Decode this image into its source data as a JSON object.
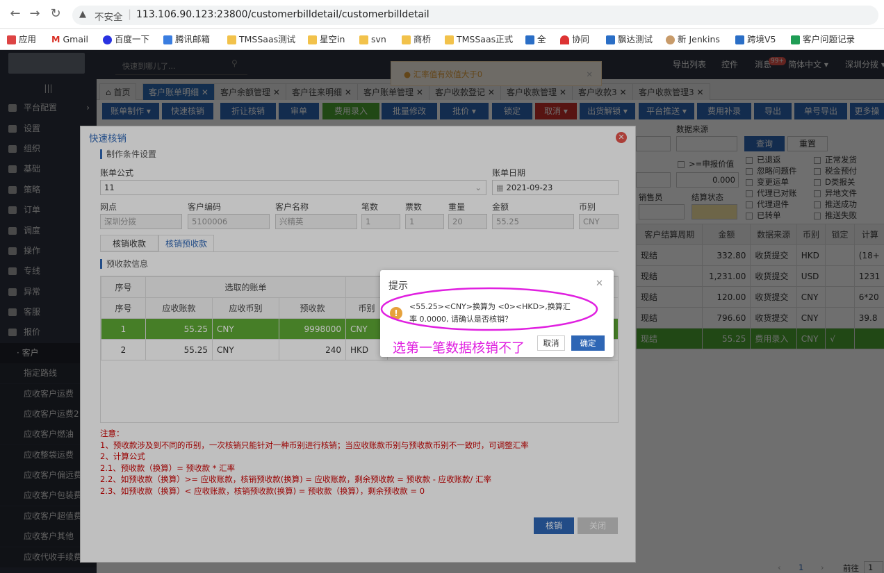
{
  "browser": {
    "security": "不安全",
    "url": "113.106.90.123:23800/customerbilldetail/customerbilldetail",
    "bookmarks": [
      "应用",
      "Gmail",
      "百度一下",
      "腾讯邮箱",
      "TMSSaas测试",
      "星空in",
      "svn",
      "商桥",
      "TMSSaas正式",
      "全",
      "协同",
      "飘达测试",
      "新 Jenkins",
      "跨境V5",
      "客户问题记录"
    ]
  },
  "header": {
    "search_placeholder": "快速到哪儿了...",
    "export_list": "导出列表",
    "controls": "控件",
    "messages": "消息",
    "msg_badge": "99+",
    "language": "简体中文",
    "branch": "深圳分拨"
  },
  "notice": "汇率值有效值大于0",
  "sidebar": {
    "items": [
      "平台配置",
      "设置",
      "组织",
      "基础",
      "策略",
      "订单",
      "调度",
      "操作",
      "专线",
      "异常",
      "客服",
      "报价",
      "客户"
    ],
    "subitems": [
      "指定路线",
      "应收客户运费",
      "应收客户运费2",
      "应收客户燃油",
      "应收整袋运费",
      "应收客户偏远费",
      "应收客户包装费",
      "应收客户超值费",
      "应收客户其他",
      "应收代收手续费"
    ]
  },
  "tabs": [
    "首页",
    "客户账单明细",
    "客户余额管理",
    "客户往来明细",
    "客户账单管理",
    "客户收款登记",
    "客户收款管理",
    "客户收款3",
    "客户收款管理3"
  ],
  "toolbar": [
    "账单制作",
    "快速核销",
    "折让核销",
    "审单",
    "费用录入",
    "批量修改",
    "批价",
    "锁定",
    "取消",
    "出货解锁",
    "平台推送",
    "费用补录",
    "导出",
    "单号导出",
    "更多操"
  ],
  "behind": {
    "data_source_label": "数据来源",
    "query": "查询",
    "reset": "重置",
    "apply_value": ">=申报价值",
    "apply_amount": "0.000",
    "salesperson": "销售员",
    "settle_status": "结算状态",
    "checks_a": [
      "已退返",
      "忽略问题件",
      "变更运单",
      "代理已对账",
      "代理退件",
      "已转单"
    ],
    "checks_b": [
      "正常发货",
      "税金预付",
      "D类报关",
      "异地文件",
      "推送成功",
      "推送失败"
    ],
    "columns": [
      "客户结算周期",
      "金额",
      "数据来源",
      "币别",
      "锁定",
      "计算"
    ],
    "rows": [
      [
        "现结",
        "332.80",
        "收货提交",
        "HKD",
        "",
        "(18+"
      ],
      [
        "现结",
        "1,231.00",
        "收货提交",
        "USD",
        "",
        "1231"
      ],
      [
        "现结",
        "120.00",
        "收货提交",
        "CNY",
        "",
        "6*20"
      ],
      [
        "现结",
        "796.60",
        "收货提交",
        "CNY",
        "",
        "39.8"
      ],
      [
        "现结",
        "55.25",
        "费用录入",
        "CNY",
        "√",
        ""
      ]
    ],
    "pager_page": "1",
    "pager_goto": "前往",
    "pager_input": "1"
  },
  "dialog": {
    "title": "快速核销",
    "section1": "制作条件设置",
    "formula_label": "账单公式",
    "formula_value": "11",
    "date_label": "账单日期",
    "date_value": "2021-09-23",
    "fields": [
      {
        "label": "网点",
        "value": "深圳分拨"
      },
      {
        "label": "客户编码",
        "value": "5100006"
      },
      {
        "label": "客户名称",
        "value": "兴精英"
      },
      {
        "label": "笔数",
        "value": "1"
      },
      {
        "label": "票数",
        "value": "1"
      },
      {
        "label": "重量",
        "value": "20"
      },
      {
        "label": "金额",
        "value": "55.25"
      },
      {
        "label": "币别",
        "value": "CNY"
      }
    ],
    "subtabs": [
      "核销收款",
      "核销预收款"
    ],
    "section2": "预收款信息",
    "grid_head1": [
      "序号",
      "选取的账单"
    ],
    "grid_head2": [
      "序号",
      "应收账款",
      "应收币别",
      "预收款",
      "币别"
    ],
    "grid_rows": [
      [
        "1",
        "55.25",
        "CNY",
        "9998000",
        "CNY"
      ],
      [
        "2",
        "55.25",
        "CNY",
        "240",
        "HKD"
      ]
    ],
    "notes": [
      "注意：",
      "1、预收款涉及到不同的币别，一次核销只能针对一种币别进行核销；当应收账款币别与预收款币别不一致时，可调整汇率",
      "2、计算公式",
      "2.1、预收款（换算）= 预收款 * 汇率",
      "2.2、如预收款（换算）>= 应收账款，核销预收款(换算) = 应收账款，剩余预收款 = 预收款 - 应收账款/ 汇率",
      "2.3、如预收款（换算）< 应收账款，核销预收款(换算) = 预收款（换算），剩余预收款 = 0"
    ],
    "confirm_btn": "核销",
    "close_btn": "关闭"
  },
  "confirm": {
    "title": "提示",
    "message": "<55.25><CNY>换算为 <0><HKD>,换算汇率 0.0000, 请确认是否核销？",
    "annotation": "选第一笔数据核销不了",
    "cancel": "取消",
    "ok": "确定"
  },
  "colors": {
    "primary": "#2e66b5",
    "green": "#4ca833",
    "red": "#c9302c",
    "annotation": "#e020e0"
  }
}
